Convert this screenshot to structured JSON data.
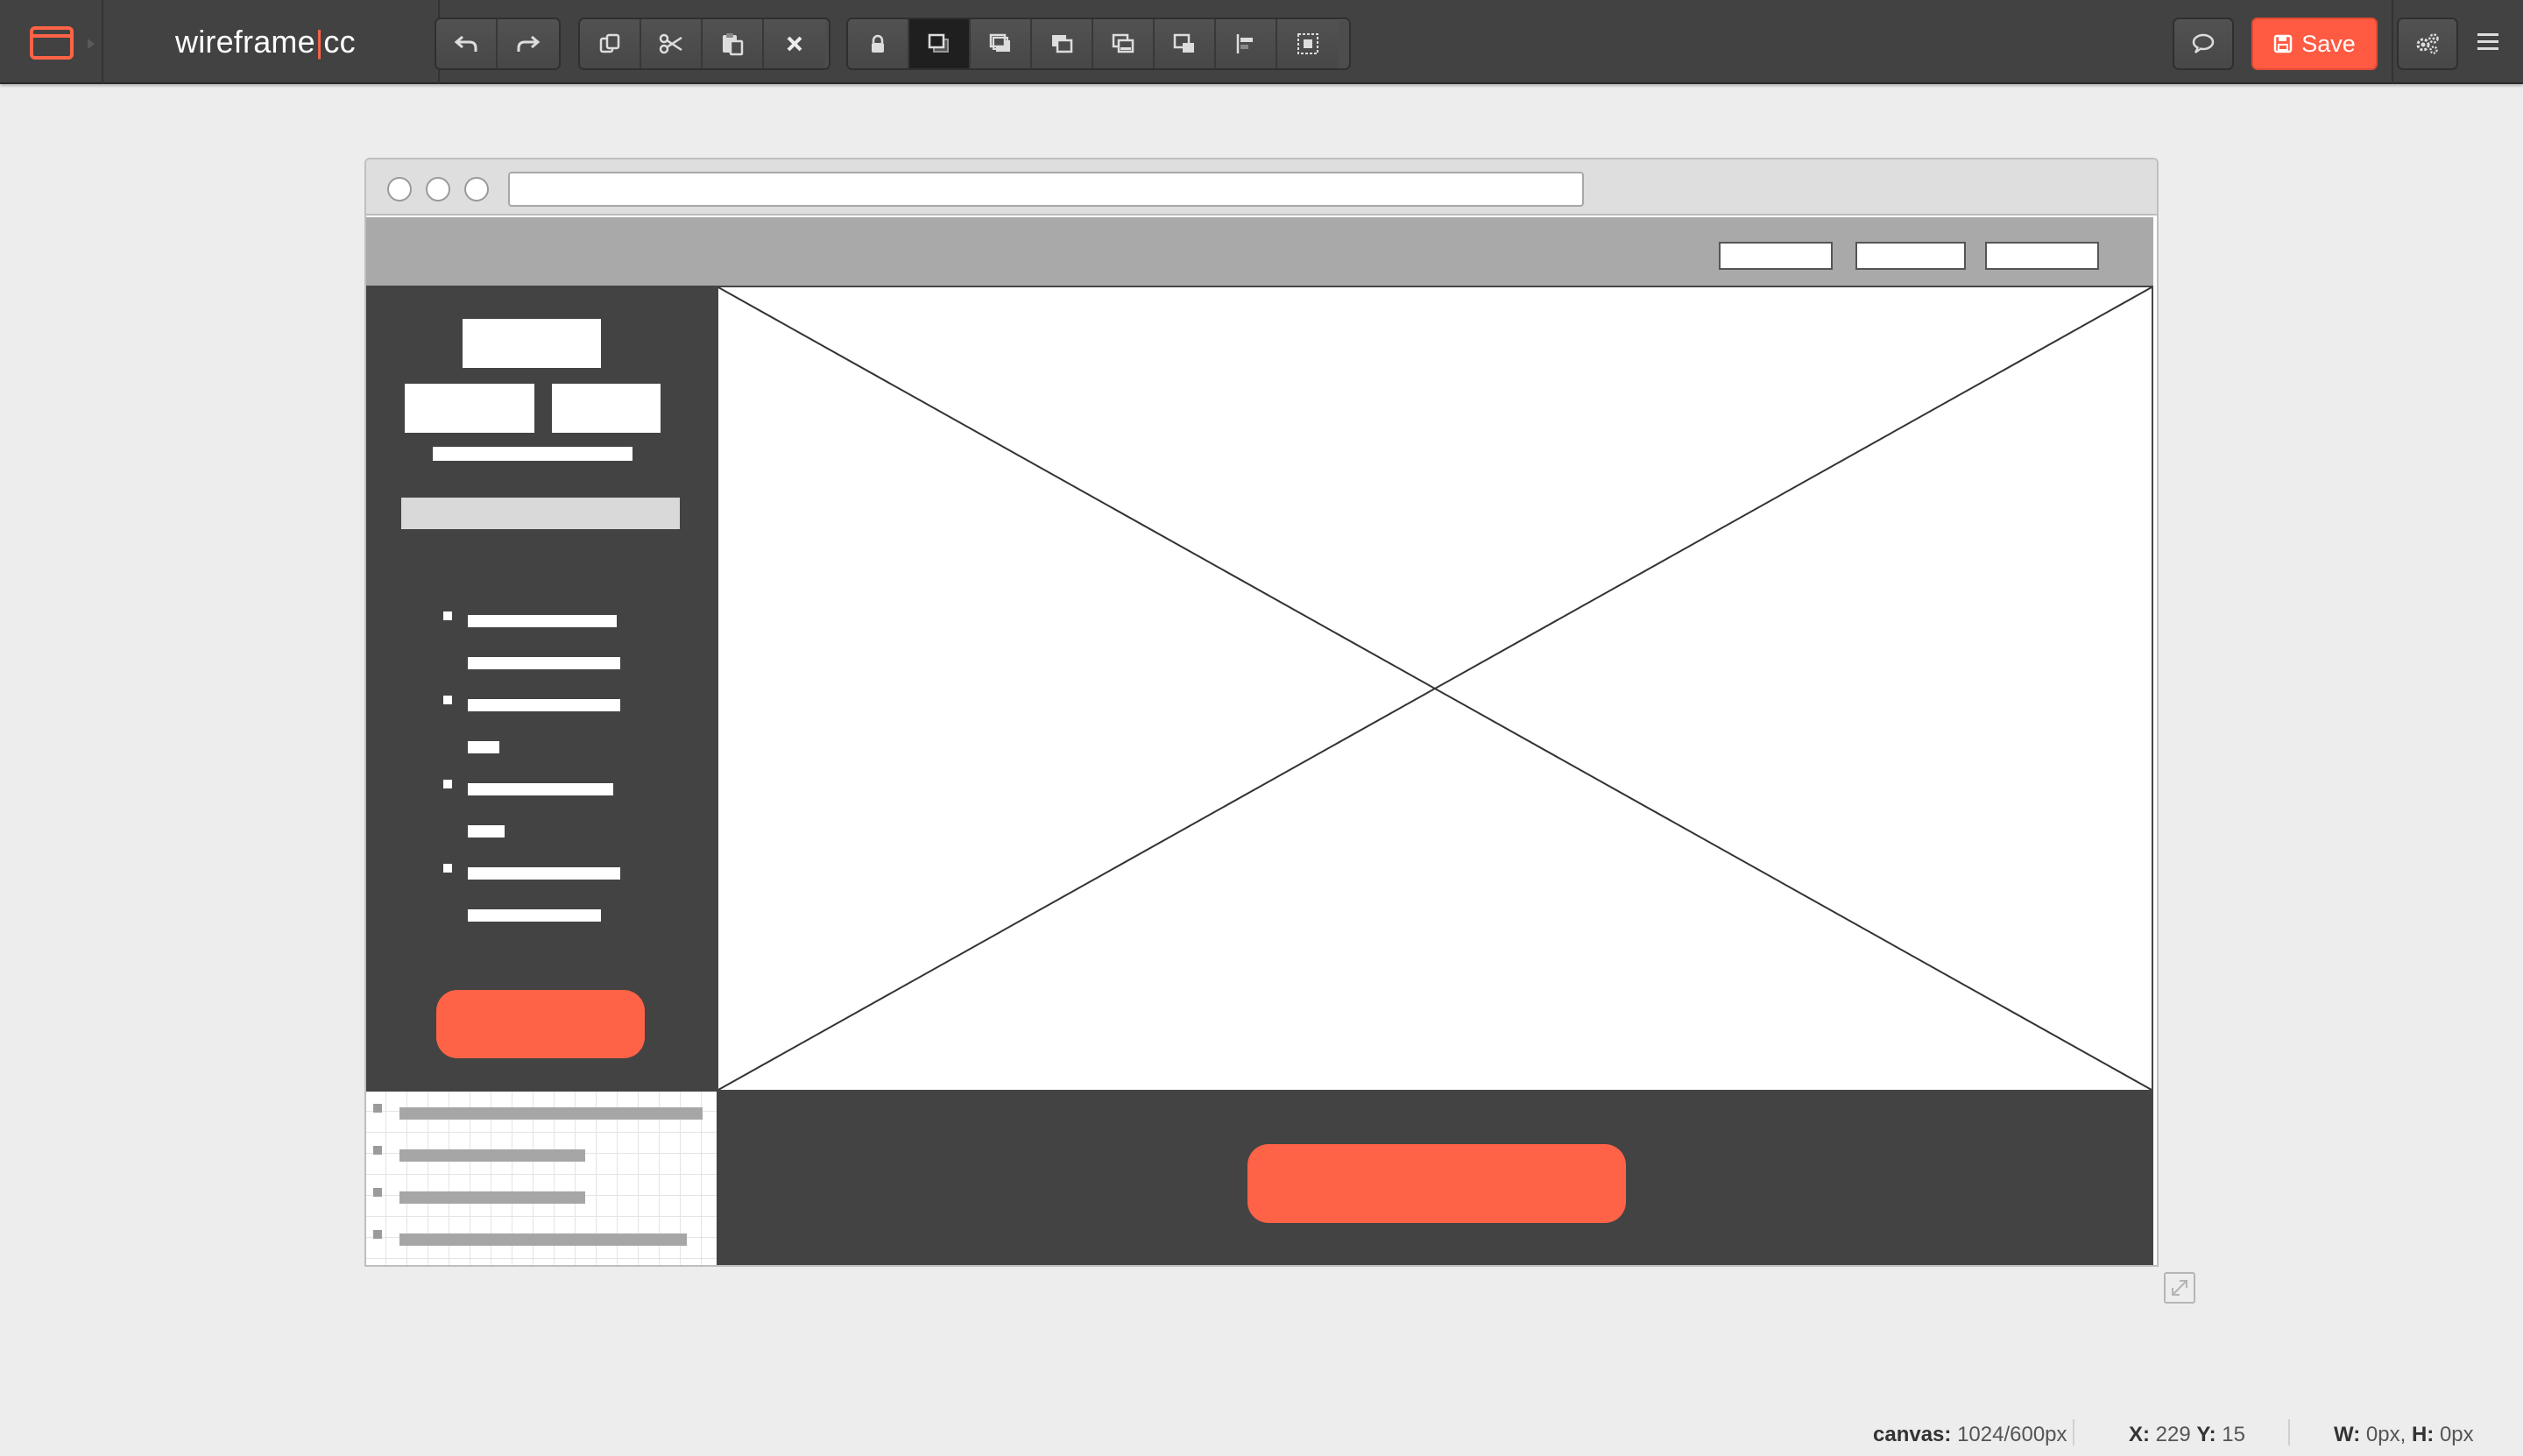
{
  "app": {
    "brand_main": "wireframe",
    "brand_sep": "|",
    "brand_suffix": "cc",
    "accent": "#ff6347"
  },
  "toolbar": {
    "history": [
      {
        "name": "undo-button",
        "icon": "undo-icon"
      },
      {
        "name": "redo-button",
        "icon": "redo-icon"
      }
    ],
    "clipboard": [
      {
        "name": "copy-button",
        "icon": "copy-icon"
      },
      {
        "name": "cut-button",
        "icon": "scissors-icon"
      },
      {
        "name": "paste-button",
        "icon": "paste-icon"
      },
      {
        "name": "delete-button",
        "icon": "close-icon"
      }
    ],
    "arrange": [
      {
        "name": "lock-button",
        "icon": "lock-icon"
      },
      {
        "name": "bring-to-front-button",
        "icon": "layer-front-icon"
      },
      {
        "name": "bring-forward-button",
        "icon": "layer-forward-icon"
      },
      {
        "name": "send-backward-button",
        "icon": "layer-backward-icon"
      },
      {
        "name": "send-to-back-button",
        "icon": "layer-back-icon"
      },
      {
        "name": "layer-offset-button",
        "icon": "layer-offset-icon"
      },
      {
        "name": "align-left-button",
        "icon": "align-left-icon"
      },
      {
        "name": "group-button",
        "icon": "group-icon"
      }
    ],
    "comment_icon": "speech-bubble-icon",
    "save_label": "Save",
    "save_icon": "floppy-disk-icon",
    "settings_icon": "gears-icon",
    "menu_icon": "hamburger-menu-icon"
  },
  "status": {
    "canvas_label": "canvas:",
    "canvas_value": "1024/600px",
    "x_label": "X:",
    "x_value": "229",
    "y_label": "Y:",
    "y_value": "15",
    "w_label": "W:",
    "w_value": "0px,",
    "h_label": "H:",
    "h_value": "0px"
  }
}
